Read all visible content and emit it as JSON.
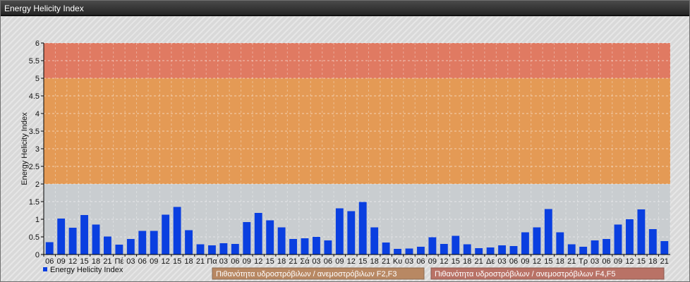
{
  "window": {
    "title": "Energy Helicity Index"
  },
  "chart_data": {
    "type": "bar",
    "ylabel": "Energy Helicity Index",
    "ylim": [
      0,
      6
    ],
    "yticks": [
      "0",
      "0.5",
      "1",
      "1.5",
      "2",
      "2.5",
      "3",
      "3.5",
      "4",
      "4.5",
      "5",
      "5.5",
      "6"
    ],
    "grid": true,
    "bar_color": "#0a3fe0",
    "x": [
      "06",
      "09",
      "12",
      "15",
      "18",
      "21",
      "Πέ",
      "03",
      "06",
      "09",
      "12",
      "15",
      "18",
      "21",
      "Πα",
      "03",
      "06",
      "09",
      "12",
      "15",
      "18",
      "21",
      "Σά",
      "03",
      "06",
      "09",
      "12",
      "15",
      "18",
      "21",
      "Κυ",
      "03",
      "06",
      "09",
      "12",
      "15",
      "18",
      "21",
      "Δε",
      "03",
      "06",
      "09",
      "12",
      "15",
      "18",
      "21",
      "Τρ",
      "03",
      "06",
      "09",
      "12",
      "15",
      "18",
      "21"
    ],
    "series": [
      {
        "name": "Energy Helicity Index",
        "values": [
          0.35,
          1.02,
          0.76,
          1.12,
          0.85,
          0.51,
          0.28,
          0.44,
          0.67,
          0.67,
          1.13,
          1.35,
          0.69,
          0.29,
          0.26,
          0.32,
          0.3,
          0.92,
          1.18,
          0.97,
          0.77,
          0.44,
          0.46,
          0.5,
          0.4,
          1.31,
          1.23,
          1.49,
          0.77,
          0.34,
          0.16,
          0.17,
          0.22,
          0.49,
          0.3,
          0.53,
          0.29,
          0.18,
          0.2,
          0.26,
          0.24,
          0.63,
          0.77,
          1.29,
          0.63,
          0.29,
          0.22,
          0.4,
          0.44,
          0.85,
          1.0,
          1.28,
          0.72,
          0.38
        ]
      }
    ],
    "bands": [
      {
        "from": 2,
        "to": 5,
        "color": "#e49a55",
        "label": "Πιθανότητα υδροστρόβιλων / ανεμοστρόβιλων F2,F3"
      },
      {
        "from": 5,
        "to": 6,
        "color": "#e07a62",
        "label": "Πιθανότητα υδροστρόβιλων / ανεμοστρόβιλων F4,F5"
      }
    ],
    "legend": "bottom-left"
  }
}
